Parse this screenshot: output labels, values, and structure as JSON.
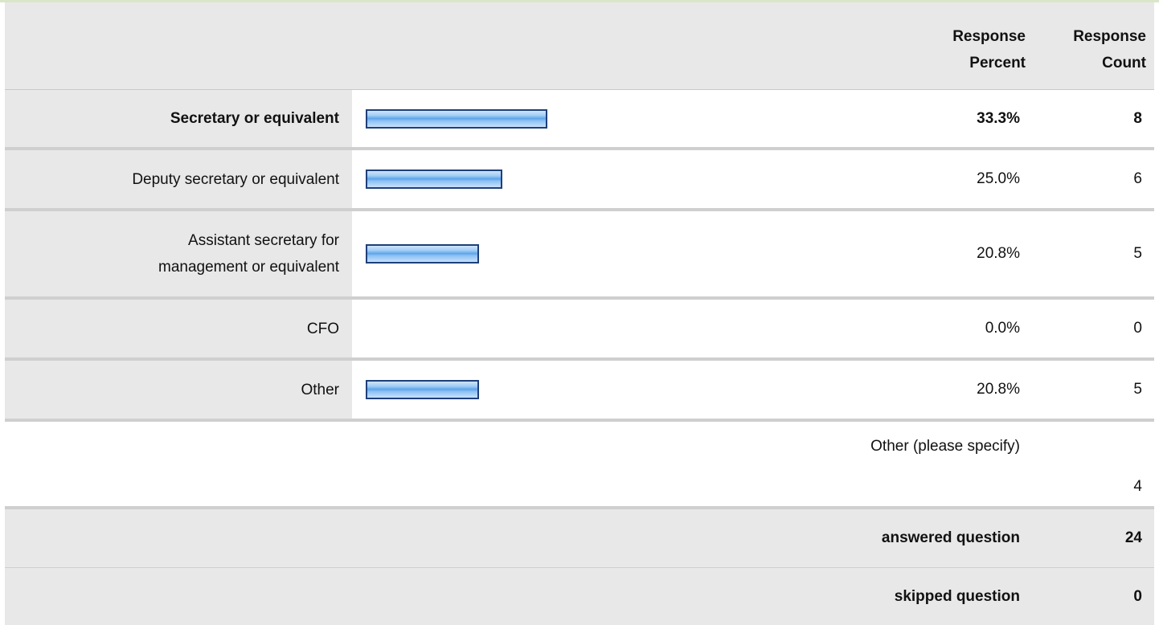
{
  "header": {
    "percent_line1": "Response",
    "percent_line2": "Percent",
    "count_line1": "Response",
    "count_line2": "Count"
  },
  "rows": [
    {
      "label": "Secretary or equivalent",
      "percent_text": "33.3%",
      "count": "8",
      "percent": 33.3
    },
    {
      "label": "Deputy secretary or equivalent",
      "percent_text": "25.0%",
      "count": "6",
      "percent": 25.0
    },
    {
      "label_line1": "Assistant secretary for",
      "label_line2": "management or equivalent",
      "percent_text": "20.8%",
      "count": "5",
      "percent": 20.8
    },
    {
      "label": "CFO",
      "percent_text": "0.0%",
      "count": "0",
      "percent": 0.0
    },
    {
      "label": "Other",
      "percent_text": "20.8%",
      "count": "5",
      "percent": 20.8
    }
  ],
  "other_specify": {
    "label": "Other (please specify)",
    "count": "4"
  },
  "summary": {
    "answered_label": "answered question",
    "answered_value": "24",
    "skipped_label": "skipped question",
    "skipped_value": "0"
  },
  "colors": {
    "bar_border": "#1f3f7a",
    "bar_fill": "#5ea3ea",
    "row_shade": "#e8e8e8"
  }
}
